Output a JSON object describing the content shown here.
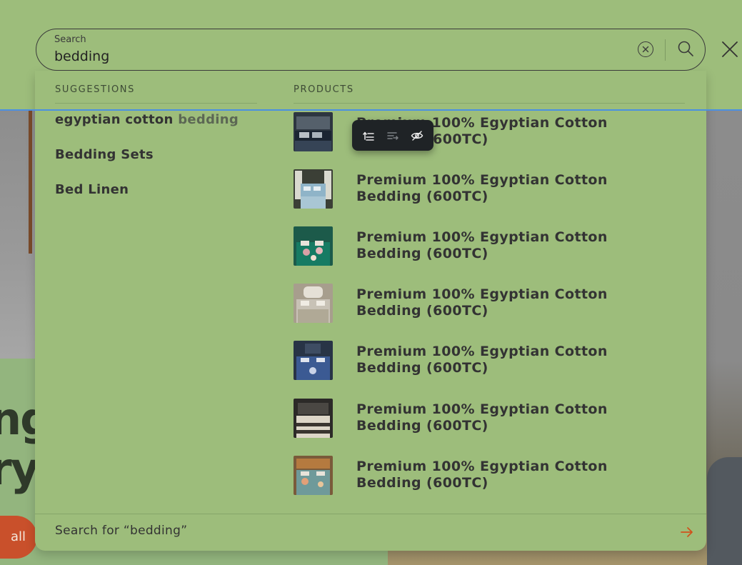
{
  "search": {
    "label": "Search",
    "value": "bedding"
  },
  "suggestions": {
    "heading": "SUGGESTIONS",
    "items": [
      {
        "prefix": "egyptian cotton ",
        "match": "bedding"
      },
      {
        "prefix": "Bedding Sets",
        "match": ""
      },
      {
        "prefix": "Bed Linen",
        "match": ""
      }
    ]
  },
  "products": {
    "heading": "PRODUCTS",
    "items": [
      {
        "title": "Premium 100% Egyptian Cotton Bedding (600TC)"
      },
      {
        "title": "Premium 100% Egyptian Cotton Bedding (600TC)"
      },
      {
        "title": "Premium 100% Egyptian Cotton Bedding (600TC)"
      },
      {
        "title": "Premium 100% Egyptian Cotton Bedding (600TC)"
      },
      {
        "title": "Premium 100% Egyptian Cotton Bedding (600TC)"
      },
      {
        "title": "Premium 100% Egyptian Cotton Bedding (600TC)"
      },
      {
        "title": "Premium 100% Egyptian Cotton Bedding (600TC)"
      }
    ]
  },
  "footer": {
    "search_for": "Search for “bedding”"
  },
  "background": {
    "hero_title": "ng\nry",
    "shop_button": "all"
  },
  "icons": {
    "clear": "clear-circle-x-icon",
    "search": "magnifier-icon",
    "close": "close-x-icon",
    "arrow": "arrow-right-icon",
    "toolbar": [
      "wrap-lines-icon",
      "unwrap-lines-icon",
      "eye-off-icon"
    ]
  },
  "colors": {
    "overlay_bg": "#9dbd7b",
    "text_dark": "#333333",
    "accent_arrow": "#d0521c",
    "selection_line": "#4a90e2",
    "toolbar_bg": "#1f2326"
  }
}
